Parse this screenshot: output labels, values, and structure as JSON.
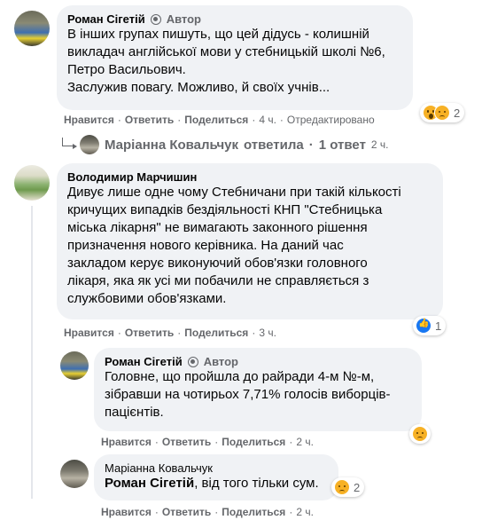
{
  "comment1": {
    "author": "Роман Сігетій",
    "badge": "Автор",
    "lines": [
      "В інших групах пишуть, що цей дідусь - колишній",
      "викладач англійської мови у стебницькій школі №6,",
      "Петро Васильович.",
      "Заслужив повагу. Можливо, й своїх учнів..."
    ],
    "actions": {
      "like": "Нравится",
      "reply": "Ответить",
      "share": "Поделиться",
      "time": "4 ч.",
      "edited": "Отредактировано"
    },
    "reactions": {
      "icons": [
        "wow-reaction-icon",
        "sad-reaction-icon"
      ],
      "count": "2"
    },
    "replies_link": {
      "author": "Маріанна Ковальчук",
      "text": "ответила",
      "count": "1 ответ",
      "time": "2 ч."
    }
  },
  "comment2": {
    "author": "Володимир Марчишин",
    "lines": [
      "Дивує лише одне чому Стебничани при такій кількості",
      "кричущих випадків бездіяльності КНП \"Стебницька",
      "міська лікарня\" не вимагають законного рішення",
      "призначення нового керівника. На даний час",
      "закладом керує виконуючий обов'язки головного",
      "лікаря, яка як усі ми побачили не справляється з",
      "службовими обов'язками."
    ],
    "actions": {
      "like": "Нравится",
      "reply": "Ответить",
      "share": "Поделиться",
      "time": "3 ч."
    },
    "reactions": {
      "icons": [
        "like-reaction-icon"
      ],
      "count": "1"
    }
  },
  "reply1": {
    "author": "Роман Сігетій",
    "badge": "Автор",
    "lines": [
      "Головне, що пройшла до райради 4-м №-м,",
      "зібравши на чотирьох 7,71% голосів виборців-",
      "пацієнтів."
    ],
    "actions": {
      "like": "Нравится",
      "reply": "Ответить",
      "share": "Поделиться",
      "time": "2 ч."
    },
    "reactions": {
      "icons": [
        "sad-reaction-icon"
      ]
    }
  },
  "reply2": {
    "author": "Маріанна Ковальчук",
    "mention": "Роман Сігетій",
    "text": ", від того тільки сум.",
    "actions": {
      "like": "Нравится",
      "reply": "Ответить",
      "share": "Поделиться",
      "time": "2 ч."
    },
    "reactions": {
      "icons": [
        "sad-reaction-icon"
      ],
      "count": "2"
    }
  },
  "colors": {
    "bubble": "#f0f2f5",
    "secondary_text": "#65676b",
    "like_blue": "#1877f2",
    "reaction_yellow": "#f7b125"
  }
}
